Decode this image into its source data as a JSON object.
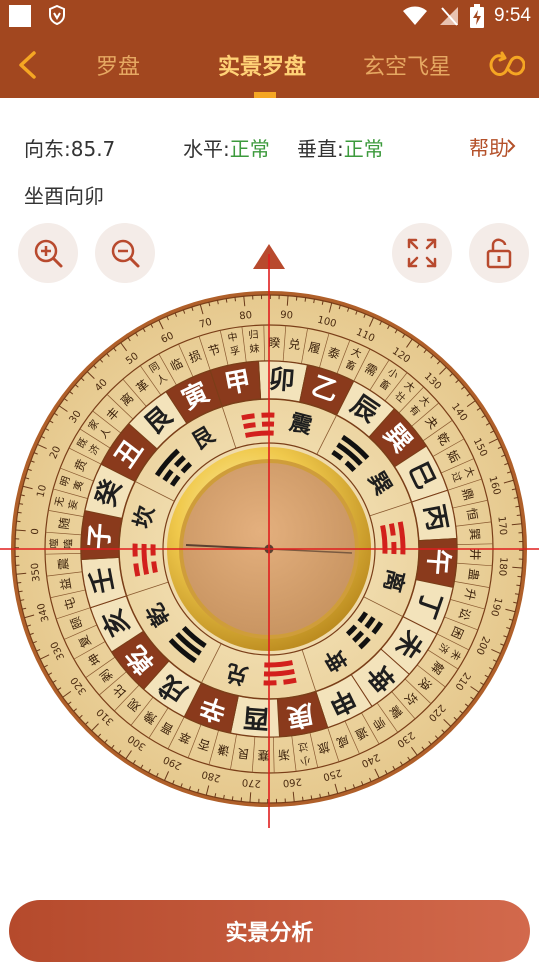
{
  "status_bar": {
    "time": "9:54"
  },
  "tabs": [
    {
      "label": "罗盘",
      "active": false
    },
    {
      "label": "实景罗盘",
      "active": true
    },
    {
      "label": "玄空飞星",
      "active": false
    }
  ],
  "readings": {
    "direction_label": "向东:",
    "direction_value": "85.7",
    "horizontal_label": "水平:",
    "horizontal_value": "正常",
    "vertical_label": "垂直:",
    "vertical_value": "正常",
    "sitting": "坐酉向卯"
  },
  "help_label": "帮助",
  "compass": {
    "heading_degrees": 85.7,
    "inner_trigrams": [
      "震",
      "巽",
      "离",
      "坤",
      "兑",
      "乾",
      "坎",
      "艮"
    ],
    "mountains": [
      "卯",
      "乙",
      "辰",
      "巽",
      "巳",
      "丙",
      "午",
      "丁",
      "未",
      "坤",
      "申",
      "庚",
      "酉",
      "辛",
      "戌",
      "乾",
      "亥",
      "壬",
      "子",
      "癸",
      "丑",
      "艮",
      "寅",
      "甲"
    ],
    "degree_labels": [
      "0",
      "10",
      "20",
      "30",
      "40",
      "50",
      "60",
      "70",
      "80",
      "90",
      "100",
      "110",
      "120",
      "130",
      "140",
      "150",
      "160",
      "170",
      "180",
      "190",
      "200",
      "210",
      "220",
      "230",
      "240",
      "250",
      "260",
      "270",
      "280",
      "290",
      "300",
      "310",
      "320",
      "330",
      "340",
      "350"
    ],
    "outer_ring_text": [
      "随",
      "无妄",
      "明夷",
      "贲",
      "既济",
      "家人",
      "丰",
      "离",
      "革",
      "同人",
      "临",
      "损",
      "节",
      "中孚",
      "归妹",
      "睽",
      "兑",
      "履",
      "泰",
      "大畜",
      "需",
      "小畜",
      "大壮",
      "大有",
      "夬",
      "乾",
      "姤",
      "大过",
      "鼎",
      "恒",
      "巽",
      "井",
      "蛊",
      "升",
      "讼",
      "困",
      "未济",
      "解",
      "涣",
      "坎",
      "蒙",
      "师",
      "遁",
      "咸",
      "旅",
      "小过",
      "渐",
      "蹇",
      "艮",
      "谦",
      "否",
      "萃",
      "晋",
      "豫",
      "观",
      "比",
      "剥",
      "坤",
      "复",
      "颐",
      "屯",
      "益",
      "震",
      "噬嗑"
    ]
  },
  "analyze_button": "实景分析",
  "colors": {
    "brand": "#a2471f",
    "accent": "#f5a623",
    "ok": "#3c9a3c",
    "button": "#c45a3c"
  }
}
